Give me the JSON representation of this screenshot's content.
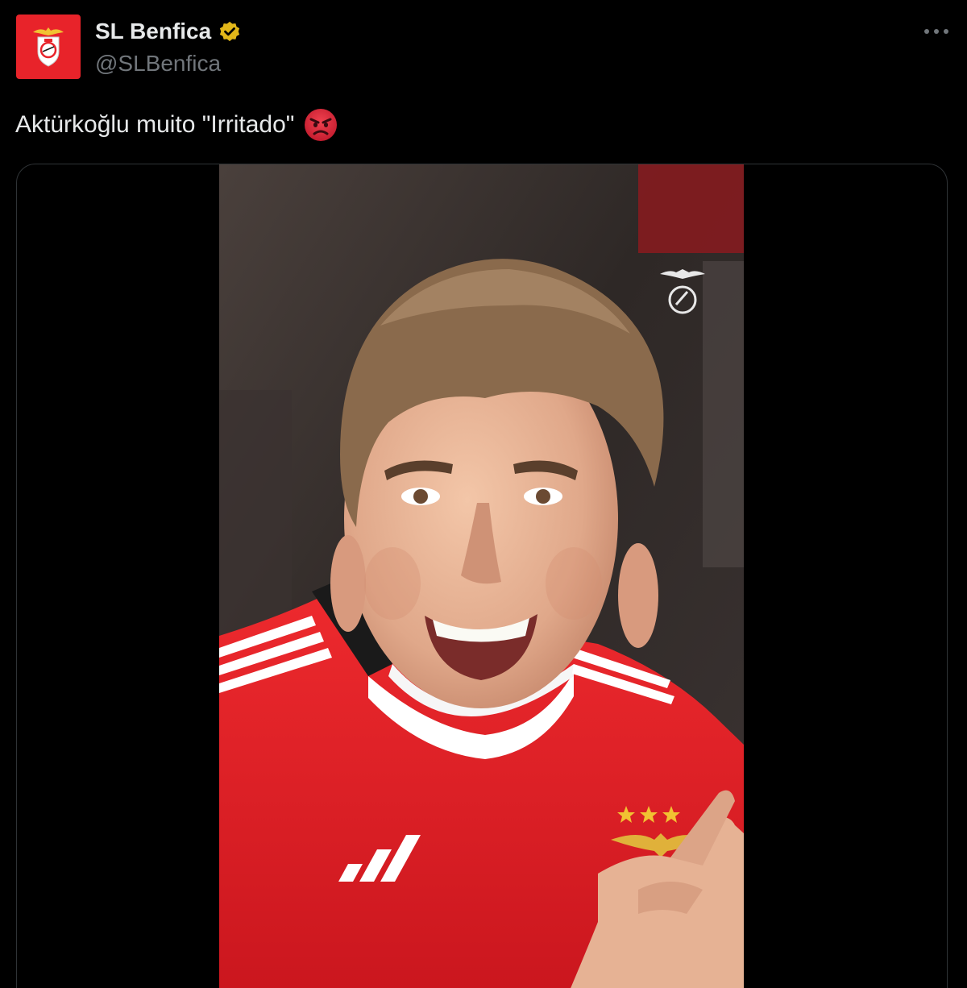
{
  "author": {
    "display_name": "SL Benfica",
    "handle": "@SLBenfica",
    "verified": true,
    "avatar_icon": "benfica-crest-icon",
    "avatar_bg": "#e8232a",
    "verified_color": "#e2b719"
  },
  "tweet": {
    "text": "Aktürkoğlu muito \"Irritado\"",
    "emoji": "angry-face-emoji",
    "emoji_color": "#e0283a"
  },
  "actions": {
    "more_icon": "more-horizontal-icon"
  },
  "media": {
    "type": "photo",
    "subject": "smiling footballer in red Benfica jersey",
    "watermark_icon": "benfica-eagle-watermark-icon",
    "jersey_color": "#e31b23",
    "background_color": "#3a3230"
  }
}
